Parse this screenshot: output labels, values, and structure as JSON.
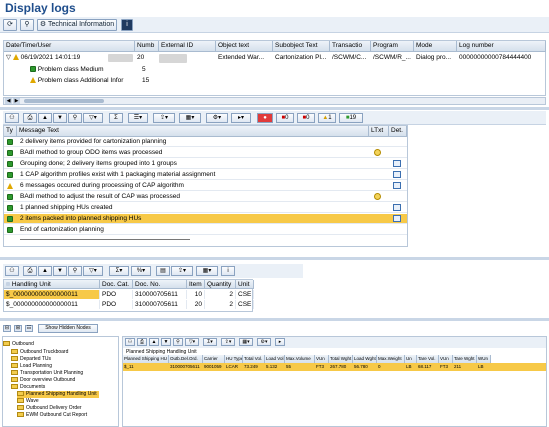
{
  "title": "Display logs",
  "toolbar": {
    "tech_info_label": "Technical Information"
  },
  "log_grid": {
    "columns": [
      "Date/Time/User",
      "Numb",
      "External ID",
      "Object text",
      "Subobject Text",
      "Transactio",
      "Program",
      "Mode",
      "Log number"
    ],
    "row": {
      "datetime": "06/19/2021 14:01:19",
      "number": "20",
      "object_text": "Extended War...",
      "subobject_text": "Cartonization Pl...",
      "transaction": "/SCWM/C...",
      "program": "/SCWM/R_...",
      "mode": "Dialog pro...",
      "log_number": "00000000000784444400"
    },
    "children": [
      {
        "label": "Problem class Medium",
        "count": "5"
      },
      {
        "label": "Problem class Additional Infor",
        "count": "15"
      }
    ]
  },
  "msg_toolbar": {
    "count_red": "0",
    "count_red2": "0",
    "count_warn": "1",
    "count_ok": "19"
  },
  "messages": {
    "headers": [
      "Ty",
      "Message Text",
      "LTxt",
      "Det."
    ],
    "rows": [
      {
        "type": "ok",
        "text": "2 delivery items provided for cartonization planning",
        "ltxt": false,
        "det": false
      },
      {
        "type": "ok",
        "text": "BAdI method to group ODO items was processed",
        "ltxt": true,
        "det": false
      },
      {
        "type": "ok",
        "text": "Grouping done; 2 delivery items grouped into 1 groups",
        "ltxt": false,
        "det": true
      },
      {
        "type": "ok",
        "text": "1 CAP algorithm profiles exist with 1 packaging material assignment",
        "ltxt": false,
        "det": true
      },
      {
        "type": "warn",
        "text": "6 messages occured during processing of CAP algorithm",
        "ltxt": false,
        "det": true
      },
      {
        "type": "ok",
        "text": "BAdI method to adjust the result of CAP was processed",
        "ltxt": true,
        "det": false
      },
      {
        "type": "ok",
        "text": "1 planned shipping HUs created",
        "ltxt": false,
        "det": true
      },
      {
        "type": "ok",
        "text": "2 items packed into planned shipping HUs",
        "ltxt": false,
        "det": true,
        "selected": true
      },
      {
        "type": "ok",
        "text": "End of cartonization planning",
        "ltxt": false,
        "det": false
      }
    ]
  },
  "hu_grid": {
    "headers": [
      "Handling Unit",
      "Doc. Cat.",
      "Doc. No.",
      "Item",
      "Quantity",
      "Unit"
    ],
    "rows": [
      {
        "hu": "$_000000000000000011",
        "cat": "PDO",
        "doc": "310000705611",
        "item": "10",
        "qty": "2",
        "unit": "CSE"
      },
      {
        "hu": "$_000000000000000011",
        "cat": "PDO",
        "doc": "310000705611",
        "item": "20",
        "qty": "2",
        "unit": "CSE"
      }
    ]
  },
  "bottom": {
    "show_hidden_label": "Show Hidden Nodes",
    "tree": [
      "Outbound",
      "Outbound Truckboard",
      "Departed TUs",
      "Load Planning",
      "Transportation Unit Planning",
      "Door overview Outbound",
      "Documents",
      "Planned Shipping Handling Unit",
      "Wave",
      "Outbound Delivery Order",
      "EWM Outbound Cut Report"
    ],
    "panel_title": "Planned Shipping Handling Unit",
    "columns": [
      "Planned Shipping HU",
      "Outb.Del.Ord.",
      "Carrier",
      "HU Type",
      "Total Vol.",
      "Load Vol.",
      "Max.Volume",
      "VUn",
      "Total Wght",
      "Load Wght",
      "Max.Weight",
      "Un",
      "Tare Vol.",
      "VUn",
      "Tare Wght",
      "WUn"
    ],
    "row": [
      "$_11",
      "310000705611",
      "9001059",
      "LCAR",
      "73.249",
      "5.132",
      "55",
      "FT3",
      "267.780",
      "56.780",
      "0",
      "LB",
      "68.117",
      "FT3",
      "211",
      "LB"
    ]
  }
}
